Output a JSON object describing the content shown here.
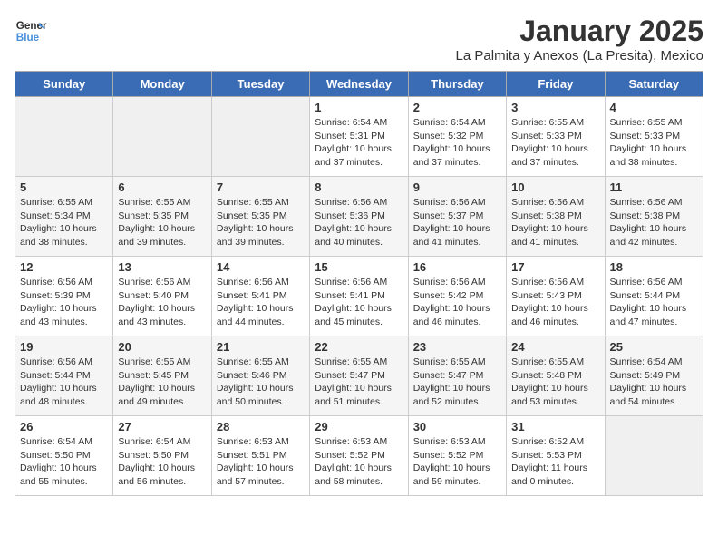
{
  "header": {
    "logo_line1": "General",
    "logo_line2": "Blue",
    "month": "January 2025",
    "location": "La Palmita y Anexos (La Presita), Mexico"
  },
  "weekdays": [
    "Sunday",
    "Monday",
    "Tuesday",
    "Wednesday",
    "Thursday",
    "Friday",
    "Saturday"
  ],
  "weeks": [
    [
      {
        "day": "",
        "info": ""
      },
      {
        "day": "",
        "info": ""
      },
      {
        "day": "",
        "info": ""
      },
      {
        "day": "1",
        "info": "Sunrise: 6:54 AM\nSunset: 5:31 PM\nDaylight: 10 hours\nand 37 minutes."
      },
      {
        "day": "2",
        "info": "Sunrise: 6:54 AM\nSunset: 5:32 PM\nDaylight: 10 hours\nand 37 minutes."
      },
      {
        "day": "3",
        "info": "Sunrise: 6:55 AM\nSunset: 5:33 PM\nDaylight: 10 hours\nand 37 minutes."
      },
      {
        "day": "4",
        "info": "Sunrise: 6:55 AM\nSunset: 5:33 PM\nDaylight: 10 hours\nand 38 minutes."
      }
    ],
    [
      {
        "day": "5",
        "info": "Sunrise: 6:55 AM\nSunset: 5:34 PM\nDaylight: 10 hours\nand 38 minutes."
      },
      {
        "day": "6",
        "info": "Sunrise: 6:55 AM\nSunset: 5:35 PM\nDaylight: 10 hours\nand 39 minutes."
      },
      {
        "day": "7",
        "info": "Sunrise: 6:55 AM\nSunset: 5:35 PM\nDaylight: 10 hours\nand 39 minutes."
      },
      {
        "day": "8",
        "info": "Sunrise: 6:56 AM\nSunset: 5:36 PM\nDaylight: 10 hours\nand 40 minutes."
      },
      {
        "day": "9",
        "info": "Sunrise: 6:56 AM\nSunset: 5:37 PM\nDaylight: 10 hours\nand 41 minutes."
      },
      {
        "day": "10",
        "info": "Sunrise: 6:56 AM\nSunset: 5:38 PM\nDaylight: 10 hours\nand 41 minutes."
      },
      {
        "day": "11",
        "info": "Sunrise: 6:56 AM\nSunset: 5:38 PM\nDaylight: 10 hours\nand 42 minutes."
      }
    ],
    [
      {
        "day": "12",
        "info": "Sunrise: 6:56 AM\nSunset: 5:39 PM\nDaylight: 10 hours\nand 43 minutes."
      },
      {
        "day": "13",
        "info": "Sunrise: 6:56 AM\nSunset: 5:40 PM\nDaylight: 10 hours\nand 43 minutes."
      },
      {
        "day": "14",
        "info": "Sunrise: 6:56 AM\nSunset: 5:41 PM\nDaylight: 10 hours\nand 44 minutes."
      },
      {
        "day": "15",
        "info": "Sunrise: 6:56 AM\nSunset: 5:41 PM\nDaylight: 10 hours\nand 45 minutes."
      },
      {
        "day": "16",
        "info": "Sunrise: 6:56 AM\nSunset: 5:42 PM\nDaylight: 10 hours\nand 46 minutes."
      },
      {
        "day": "17",
        "info": "Sunrise: 6:56 AM\nSunset: 5:43 PM\nDaylight: 10 hours\nand 46 minutes."
      },
      {
        "day": "18",
        "info": "Sunrise: 6:56 AM\nSunset: 5:44 PM\nDaylight: 10 hours\nand 47 minutes."
      }
    ],
    [
      {
        "day": "19",
        "info": "Sunrise: 6:56 AM\nSunset: 5:44 PM\nDaylight: 10 hours\nand 48 minutes."
      },
      {
        "day": "20",
        "info": "Sunrise: 6:55 AM\nSunset: 5:45 PM\nDaylight: 10 hours\nand 49 minutes."
      },
      {
        "day": "21",
        "info": "Sunrise: 6:55 AM\nSunset: 5:46 PM\nDaylight: 10 hours\nand 50 minutes."
      },
      {
        "day": "22",
        "info": "Sunrise: 6:55 AM\nSunset: 5:47 PM\nDaylight: 10 hours\nand 51 minutes."
      },
      {
        "day": "23",
        "info": "Sunrise: 6:55 AM\nSunset: 5:47 PM\nDaylight: 10 hours\nand 52 minutes."
      },
      {
        "day": "24",
        "info": "Sunrise: 6:55 AM\nSunset: 5:48 PM\nDaylight: 10 hours\nand 53 minutes."
      },
      {
        "day": "25",
        "info": "Sunrise: 6:54 AM\nSunset: 5:49 PM\nDaylight: 10 hours\nand 54 minutes."
      }
    ],
    [
      {
        "day": "26",
        "info": "Sunrise: 6:54 AM\nSunset: 5:50 PM\nDaylight: 10 hours\nand 55 minutes."
      },
      {
        "day": "27",
        "info": "Sunrise: 6:54 AM\nSunset: 5:50 PM\nDaylight: 10 hours\nand 56 minutes."
      },
      {
        "day": "28",
        "info": "Sunrise: 6:53 AM\nSunset: 5:51 PM\nDaylight: 10 hours\nand 57 minutes."
      },
      {
        "day": "29",
        "info": "Sunrise: 6:53 AM\nSunset: 5:52 PM\nDaylight: 10 hours\nand 58 minutes."
      },
      {
        "day": "30",
        "info": "Sunrise: 6:53 AM\nSunset: 5:52 PM\nDaylight: 10 hours\nand 59 minutes."
      },
      {
        "day": "31",
        "info": "Sunrise: 6:52 AM\nSunset: 5:53 PM\nDaylight: 11 hours\nand 0 minutes."
      },
      {
        "day": "",
        "info": ""
      }
    ]
  ]
}
